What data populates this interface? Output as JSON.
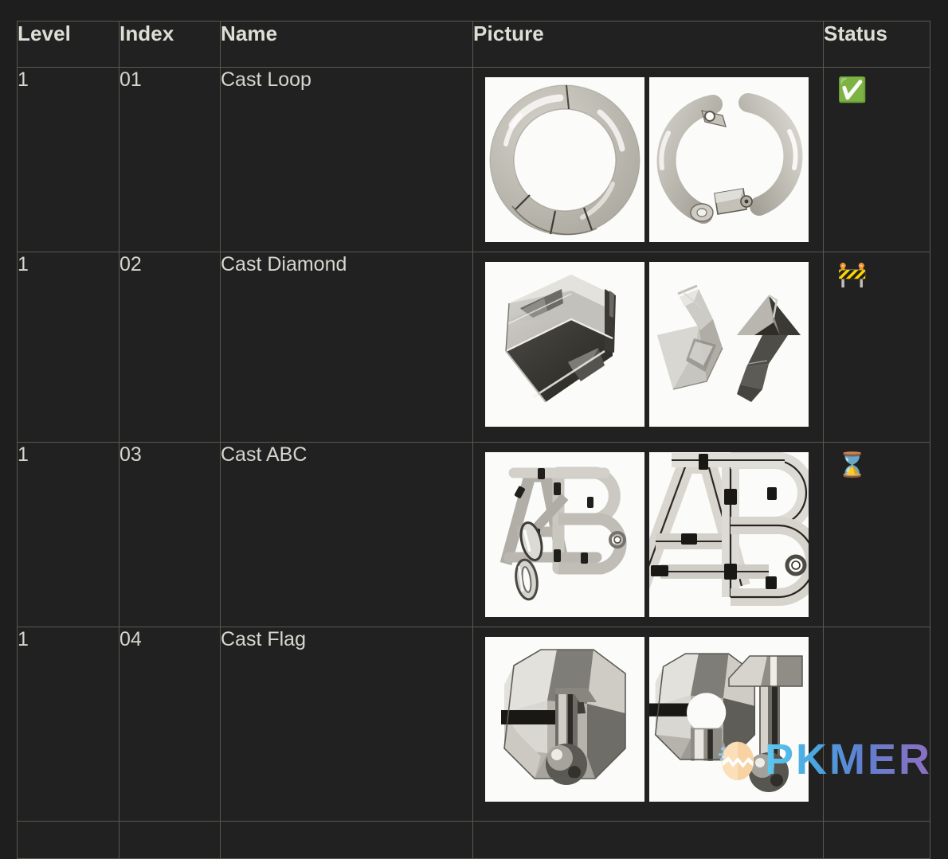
{
  "table": {
    "columns": [
      {
        "key": "level",
        "label": "Level"
      },
      {
        "key": "index",
        "label": "Index"
      },
      {
        "key": "name",
        "label": "Name"
      },
      {
        "key": "picture",
        "label": "Picture"
      },
      {
        "key": "status",
        "label": "Status"
      }
    ],
    "rows": [
      {
        "level": "1",
        "index": "01",
        "name": "Cast Loop",
        "status_icon": "✅",
        "status_name": "check-mark-button-icon",
        "pictures": [
          {
            "alt": "cast-loop-assembled",
            "caption": ""
          },
          {
            "alt": "cast-loop-disassembled",
            "caption": ""
          }
        ]
      },
      {
        "level": "1",
        "index": "02",
        "name": "Cast Diamond",
        "status_icon": "🚧",
        "status_name": "construction-barrier-icon",
        "pictures": [
          {
            "alt": "cast-diamond-assembled",
            "caption": ""
          },
          {
            "alt": "cast-diamond-disassembled",
            "caption": ""
          }
        ]
      },
      {
        "level": "1",
        "index": "03",
        "name": "Cast ABC",
        "status_icon": "⌛",
        "status_name": "hourglass-icon",
        "pictures": [
          {
            "alt": "cast-abc-assembled",
            "caption": ""
          },
          {
            "alt": "cast-abc-closeup",
            "caption": ""
          }
        ]
      },
      {
        "level": "1",
        "index": "04",
        "name": "Cast Flag",
        "status_icon": "",
        "status_name": "status-empty",
        "pictures": [
          {
            "alt": "cast-flag-assembled",
            "caption": ""
          },
          {
            "alt": "cast-flag-disassembled",
            "caption": ""
          }
        ]
      },
      {
        "level": "",
        "index": "",
        "name": "",
        "status_icon": "",
        "status_name": "status-empty",
        "pictures": []
      }
    ]
  },
  "watermark": {
    "text": "PKMER",
    "icon": "cracked-egg-icon"
  },
  "colors": {
    "background": "#1e1e1e",
    "cell_background": "#212121",
    "border": "#565a50",
    "text": "#d6d6ce",
    "picture_background": "#fbfbf9",
    "status_ok": "#2ecb3f",
    "status_construction": "#f5c518",
    "watermark_start": "#5ec8f0",
    "watermark_end": "#8e6fc0"
  }
}
